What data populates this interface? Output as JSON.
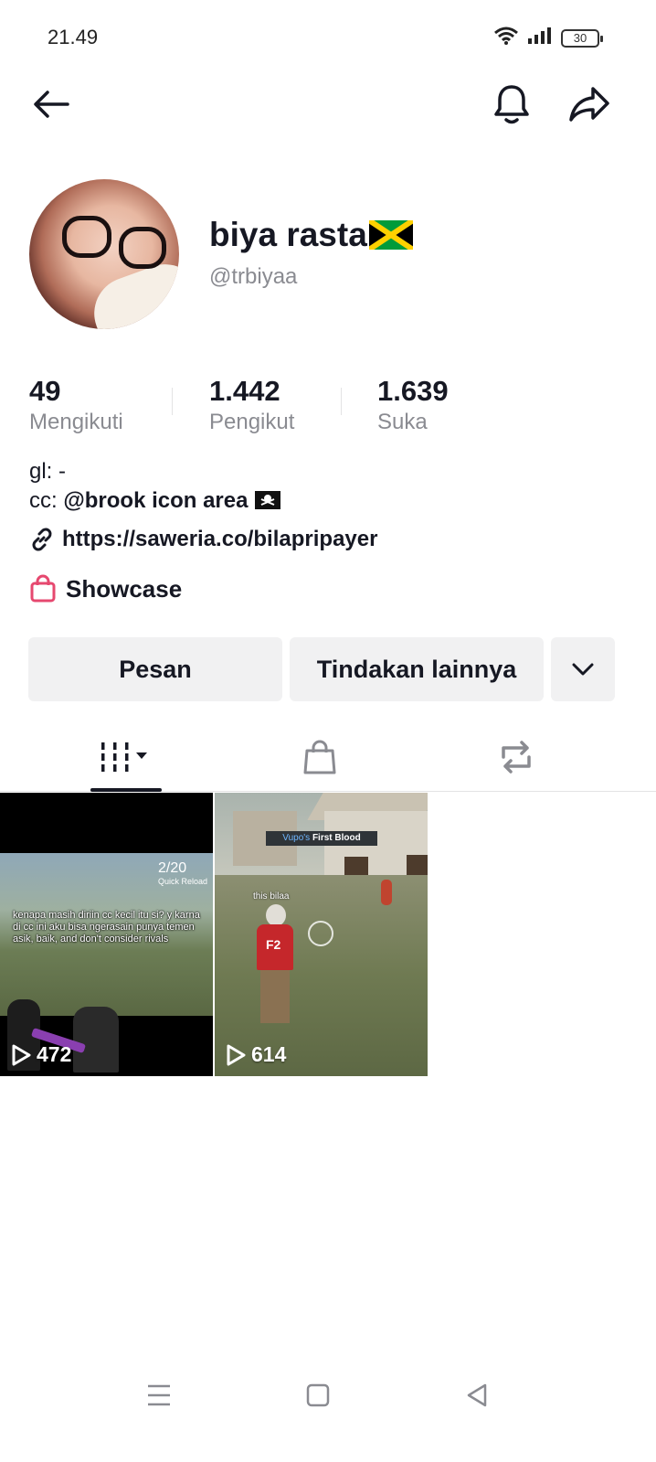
{
  "status_bar": {
    "time": "21.49",
    "battery": "30"
  },
  "profile": {
    "display_name": "biya rasta",
    "username": "@trbiyaa",
    "stats": [
      {
        "value": "49",
        "label": "Mengikuti"
      },
      {
        "value": "1.442",
        "label": "Pengikut"
      },
      {
        "value": "1.639",
        "label": "Suka"
      }
    ],
    "bio_line1": "gl: -",
    "bio_line2_prefix": "cc: ",
    "bio_line2_mention": "@brook icon area",
    "link": "https://saweria.co/bilapripayer",
    "showcase_label": "Showcase"
  },
  "actions": {
    "message_label": "Pesan",
    "more_label": "Tindakan lainnya"
  },
  "videos": [
    {
      "views": "472",
      "caption": "kenapa masih diriin cc kecil itu si? y karna di cc ini aku bisa ngerasain punya temen asik, baik, and don't consider rivals",
      "hud_count": "2/20",
      "hud_label": "Quick Reload"
    },
    {
      "views": "614",
      "banner_name": "Vupo's",
      "banner_text": "First Blood",
      "player_tag": "this bilaa"
    }
  ],
  "colors": {
    "text": "#161823",
    "muted": "#8a8b91",
    "button_bg": "#f1f1f2",
    "showcase": "#e6486f"
  }
}
